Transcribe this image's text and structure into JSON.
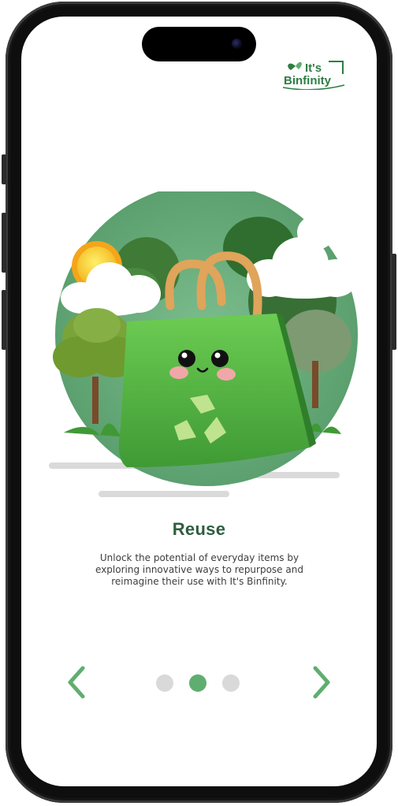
{
  "brand": {
    "logo_text_line1": "It's",
    "logo_text_line2": "Binfinity"
  },
  "slide": {
    "title": "Reuse",
    "description": "Unlock the potential of everyday items by exploring innovative ways to repurpose and reimagine their use with It's Binfinity."
  },
  "pagination": {
    "total": 3,
    "active_index": 1
  },
  "icons": {
    "prev": "chevron-left-icon",
    "next": "chevron-right-icon"
  },
  "colors": {
    "accent": "#5fae6f",
    "title": "#2f5e3f",
    "dot_inactive": "#d9d9d9",
    "bag_green": "#5dbb4d",
    "circle_bg": "#66ad7b"
  }
}
